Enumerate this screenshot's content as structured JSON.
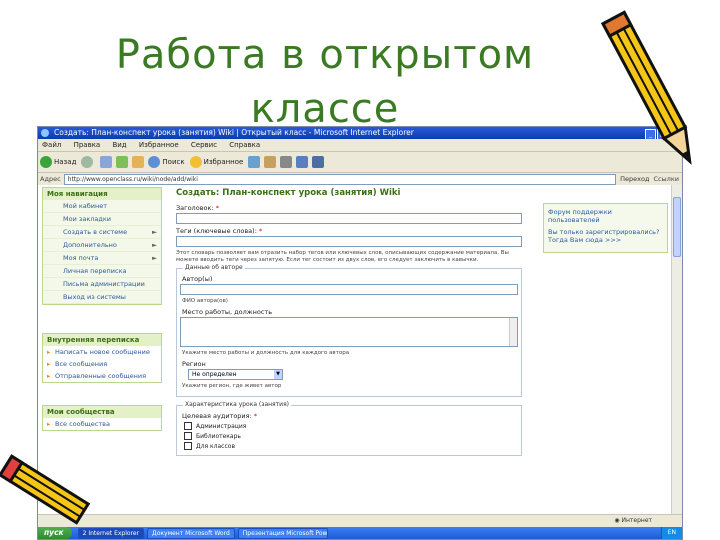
{
  "slide": {
    "title": "Работа в открытом классе"
  },
  "browser": {
    "window_title": "Создать: План-конспект урока (занятия) Wiki | Открытый класс - Microsoft Internet Explorer",
    "menu": [
      "Файл",
      "Правка",
      "Вид",
      "Избранное",
      "Сервис",
      "Справка"
    ],
    "toolbar": {
      "back": "Назад",
      "search": "Поиск",
      "favorites": "Избранное"
    },
    "address": {
      "label": "Адрес",
      "url": "http://www.openclass.ru/wiki/node/add/wiki",
      "go": "Переход",
      "links": "Ссылки"
    }
  },
  "nav": {
    "my_nav": {
      "title": "Моя навигация",
      "items": [
        "Мой кабинет",
        "Мои закладки",
        "Создать в системе",
        "Дополнительно",
        "Моя почта",
        "Личная переписка",
        "Письма администрации",
        "Выход из системы"
      ]
    },
    "messages": {
      "title": "Внутренняя переписка",
      "items": [
        "Написать новое сообщение",
        "Все сообщения",
        "Отправленные сообщения"
      ]
    },
    "communities": {
      "title": "Мои сообщества",
      "items": [
        "Все сообщества"
      ]
    }
  },
  "form": {
    "heading": "Создать: План-конспект урока (занятия) Wiki",
    "title_label": "Заголовок",
    "keywords_label": "Теги (ключевые слова)",
    "note": "Этот словарь позволяет вам отразить набор тегов или ключевых слов, описывающих содержание материала. Вы можете вводить теги через запятую. Если тег состоит из двух слов, его следует заключить в кавычки.",
    "authors_legend": "Данные об авторе",
    "authors_label": "Автор(ы)",
    "authors_hint": "ФИО автора(ов)",
    "workplace_label": "Место работы, должность",
    "workplace_hint": "Укажите место работы и должность для каждого автора",
    "region_label": "Регион",
    "region_value": "Не определен",
    "region_hint": "Укажите регион, где живет автор",
    "lesson_legend": "Характеристика урока (занятия)",
    "audience_label": "Целевая аудитория",
    "checkboxes": [
      "Администрация",
      "Библиотекарь",
      "Для классов"
    ]
  },
  "sidebar_right": {
    "links": [
      "Форум поддержки пользователей",
      "Вы только зарегистрировались? Тогда Вам сюда >>>"
    ]
  },
  "status": {
    "left": "",
    "right": "Интернет"
  },
  "taskbar": {
    "start": "пуск",
    "tasks": [
      "2 Internet Explorer",
      "Документ Microsoft Word",
      "Презентация Microsoft PowerPoint"
    ],
    "clock": "EN"
  },
  "colors": {
    "title_green": "#3a7a23",
    "nav_green": "#3c6e16",
    "link_blue": "#2c5a9a"
  }
}
